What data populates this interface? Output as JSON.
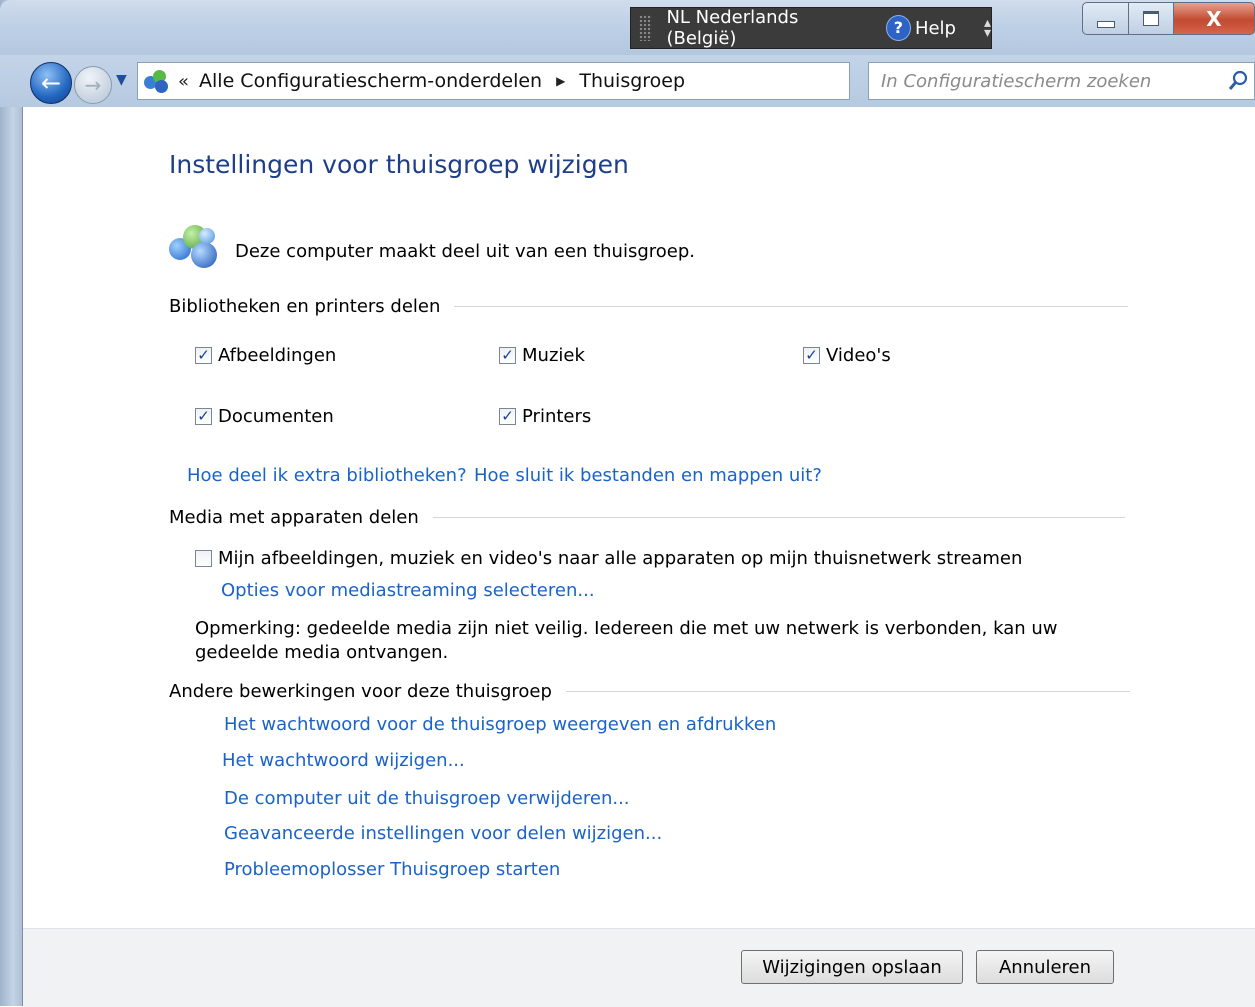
{
  "window": {
    "language_bar": {
      "language": "NL Nederlands (België)",
      "help_label": "Help"
    },
    "controls": {
      "close_label": "X"
    }
  },
  "nav": {
    "address": {
      "separator": "«",
      "crumbs": [
        "Alle Configuratiescherm-onderdelen",
        "Thuisgroep"
      ]
    },
    "search": {
      "placeholder": "In Configuratiescherm zoeken"
    }
  },
  "page": {
    "title": "Instellingen voor thuisgroep wijzigen",
    "status": "Deze computer maakt deel uit van een thuisgroep.",
    "share_section": {
      "heading": "Bibliotheken en printers delen",
      "items": [
        {
          "label": "Afbeeldingen",
          "checked": true
        },
        {
          "label": "Muziek",
          "checked": true
        },
        {
          "label": "Video's",
          "checked": true
        },
        {
          "label": "Documenten",
          "checked": true
        },
        {
          "label": "Printers",
          "checked": true
        }
      ],
      "links": [
        "Hoe deel ik extra bibliotheken?",
        "Hoe sluit ik bestanden en mappen uit?"
      ]
    },
    "media_section": {
      "heading": "Media met apparaten delen",
      "stream_label": "Mijn afbeeldingen, muziek en video's naar alle apparaten op mijn thuisnetwerk streamen",
      "stream_checked": false,
      "options_link": "Opties voor mediastreaming selecteren...",
      "note": "Opmerking: gedeelde media zijn niet veilig. Iedereen die met uw netwerk is verbonden, kan uw gedeelde media ontvangen."
    },
    "other_section": {
      "heading": "Andere bewerkingen voor deze thuisgroep",
      "links": [
        "Het wachtwoord voor de thuisgroep weergeven en afdrukken",
        "Het wachtwoord wijzigen...",
        "De computer uit de thuisgroep verwijderen...",
        "Geavanceerde instellingen voor delen wijzigen...",
        "Probleemoplosser Thuisgroep starten"
      ]
    }
  },
  "footer": {
    "save_label": "Wijzigingen opslaan",
    "cancel_label": "Annuleren"
  },
  "colors": {
    "link": "#1a63c8",
    "title": "#1e3e8a",
    "accent": "#2266c0"
  }
}
